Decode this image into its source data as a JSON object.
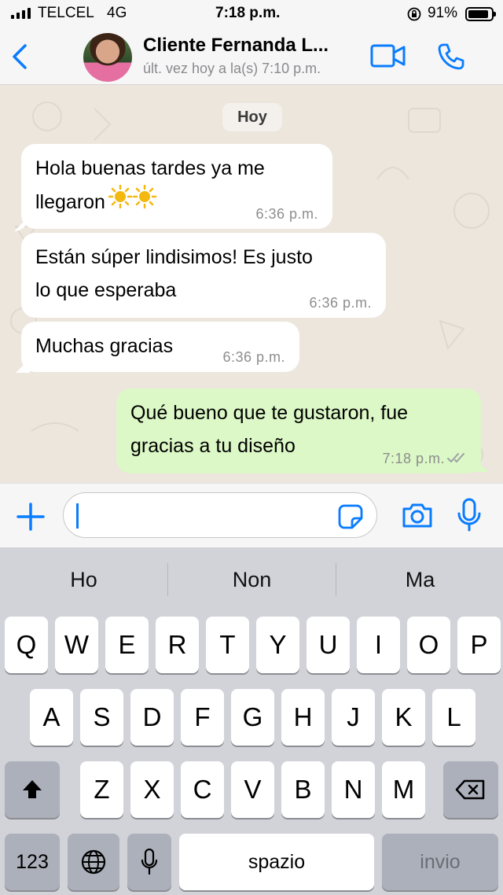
{
  "status_bar": {
    "carrier": "TELCEL",
    "network": "4G",
    "time": "7:18 p.m.",
    "battery": "91%",
    "battery_level": 0.91
  },
  "header": {
    "contact_name": "Cliente Fernanda L...",
    "last_seen": "últ. vez hoy a la(s) 7:10 p.m.",
    "icons": [
      "chevron-left-icon",
      "video-call-icon",
      "phone-icon"
    ]
  },
  "chat": {
    "date_label": "Hoy",
    "messages": [
      {
        "direction": "incoming",
        "line1": "Hola buenas tardes ya me",
        "line2": "llegaron",
        "emoji": "☀️☀️",
        "time": "6:36 p.m."
      },
      {
        "direction": "incoming",
        "line1": "Están súper lindisimos! Es justo",
        "line2": "lo que esperaba",
        "time": "6:36 p.m."
      },
      {
        "direction": "incoming",
        "line1": "Muchas gracias",
        "time": "6:36 p.m."
      },
      {
        "direction": "outgoing",
        "line1": "Qué bueno que te gustaron, fue",
        "line2": "gracias a tu diseño",
        "time": "7:18 p.m.",
        "status": "read"
      }
    ]
  },
  "input_bar": {
    "value": "",
    "icons": [
      "plus-icon",
      "sticker-icon",
      "camera-icon",
      "microphone-icon"
    ]
  },
  "keyboard": {
    "suggestions": [
      "Ho",
      "Non",
      "Ma"
    ],
    "row1": [
      "Q",
      "W",
      "E",
      "R",
      "T",
      "Y",
      "U",
      "I",
      "O",
      "P"
    ],
    "row2": [
      "A",
      "S",
      "D",
      "F",
      "G",
      "H",
      "J",
      "K",
      "L"
    ],
    "row3": [
      "Z",
      "X",
      "C",
      "V",
      "B",
      "N",
      "M"
    ],
    "numbers_key": "123",
    "space_key": "spazio",
    "return_key": "invio"
  },
  "colors": {
    "accent": "#0a7cff",
    "incoming_bubble": "#ffffff",
    "outgoing_bubble": "#dcf8c6",
    "chat_background": "#ece6dd"
  }
}
